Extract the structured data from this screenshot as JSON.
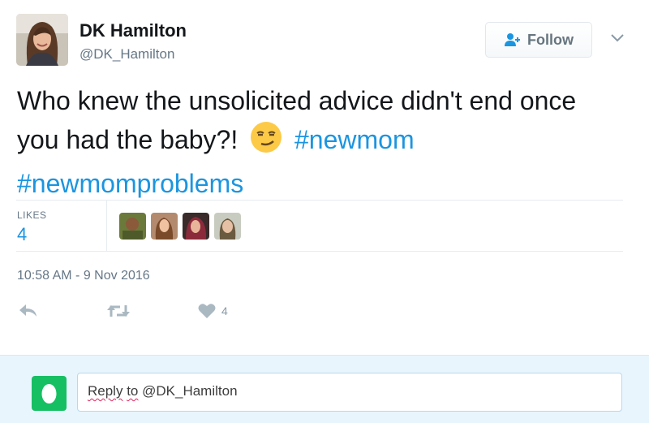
{
  "user": {
    "display_name": "DK Hamilton",
    "handle": "@DK_Hamilton"
  },
  "follow_button": {
    "label": "Follow"
  },
  "tweet": {
    "text": "Who knew the unsolicited advice didn't end once you had the baby?!",
    "emoji": "smirking-face-emoji",
    "hashtags": [
      "#newmom",
      "#newmomproblems"
    ]
  },
  "likes": {
    "label": "LIKES",
    "count": "4",
    "likers": [
      "liker-avatar-1",
      "liker-avatar-2",
      "liker-avatar-3",
      "liker-avatar-4"
    ]
  },
  "timestamp": "10:58 AM - 9 Nov 2016",
  "actions": {
    "reply_icon": "reply-icon",
    "retweet_icon": "retweet-icon",
    "like_icon": "heart-icon",
    "like_count": "4"
  },
  "reply_box": {
    "reply_word": "Reply",
    "to_word": "to",
    "mention": "@DK_Hamilton"
  },
  "colors": {
    "link": "#1b95e0",
    "secondary_text": "#657786",
    "reply_bg": "#e8f5fd",
    "my_avatar": "#17bf63"
  }
}
